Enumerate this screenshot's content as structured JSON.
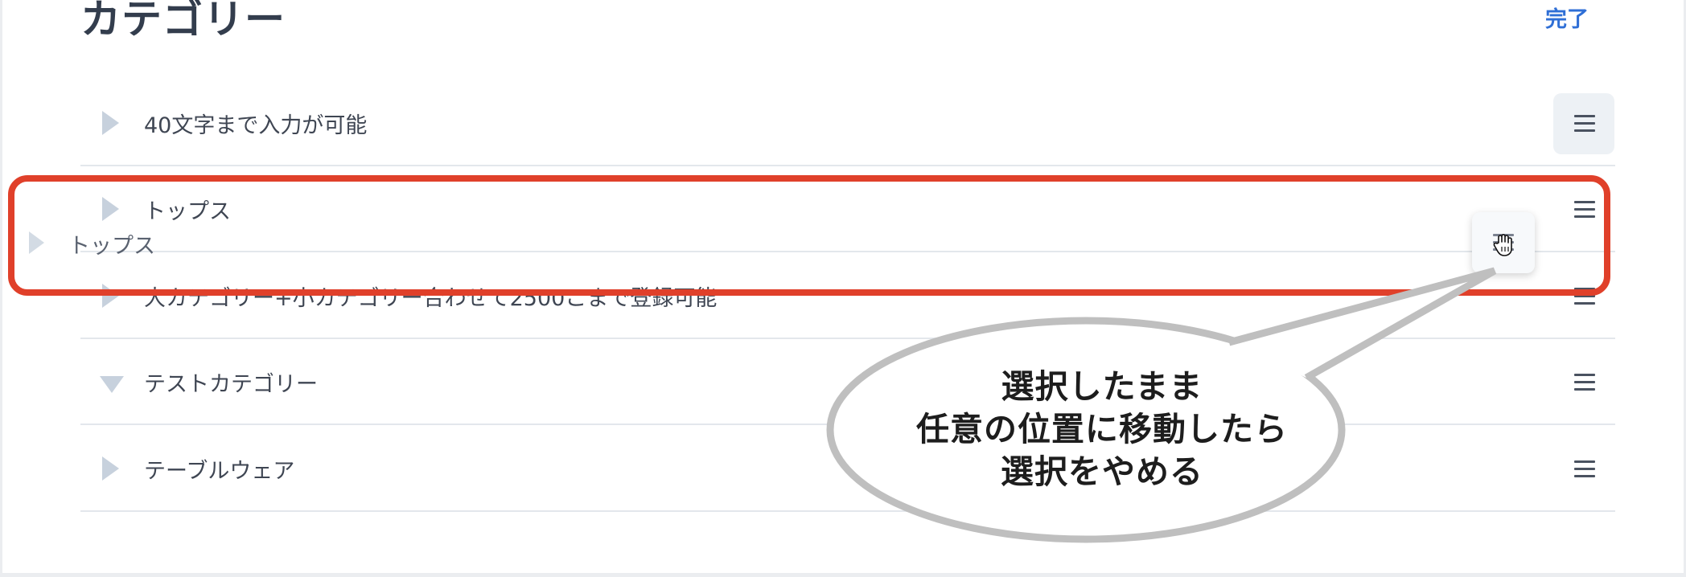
{
  "header": {
    "title": "カテゴリー",
    "done_label": "完了"
  },
  "categories": [
    {
      "label": "40文字まで入力が可能",
      "expanded": false
    },
    {
      "label": "トップス",
      "expanded": false
    },
    {
      "label": "大カテゴリー+小カテゴリー合わせて2500こまで登録可能",
      "expanded": false
    },
    {
      "label": "テストカテゴリー",
      "expanded": true
    },
    {
      "label": "テーブルウェア",
      "expanded": false
    }
  ],
  "dragging": {
    "label": "トップス"
  },
  "annotation": {
    "line1": "選択したまま",
    "line2": "任意の位置に移動したら",
    "line3": "選択をやめる"
  },
  "colors": {
    "highlight": "#e0402a",
    "accent": "#2f6fd6",
    "callout_border": "#bfbfbf"
  },
  "icons": {
    "expand": "chevron-right-icon",
    "collapse": "chevron-down-icon",
    "drag": "hamburger-icon",
    "cursor": "grab-hand-icon"
  }
}
